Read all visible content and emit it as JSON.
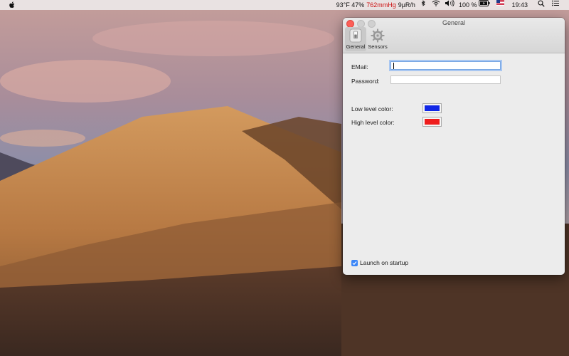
{
  "menubar": {
    "weather": "93°F 47%",
    "pressure": "762mmHg",
    "radiation": "9μR/h",
    "battery_percent": "100 %",
    "clock": "19:43"
  },
  "window": {
    "title": "General",
    "toolbar": [
      {
        "label": "General",
        "active": true
      },
      {
        "label": "Sensors",
        "active": false
      }
    ],
    "email_label": "EMail:",
    "email_value": "",
    "password_label": "Password:",
    "password_value": "",
    "low_color_label": "Low level color:",
    "low_color": "#1026e6",
    "high_color_label": "High level color:",
    "high_color": "#ef1d1d",
    "startup_label": "Launch on startup",
    "startup_checked": true
  },
  "colors": {
    "accent": "#3b86f7",
    "close_button": "#fc5f57"
  }
}
